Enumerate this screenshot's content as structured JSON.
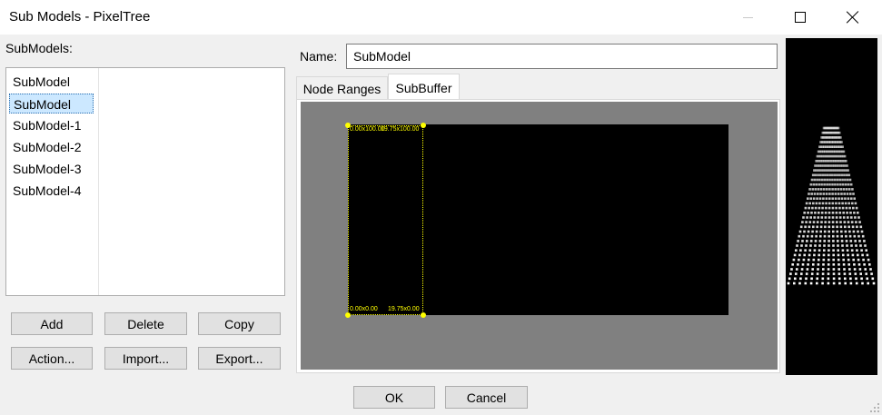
{
  "window": {
    "title": "Sub Models - PixelTree"
  },
  "submodels": {
    "label": "SubModels:",
    "items": [
      "SubModel",
      "SubModel",
      "SubModel-1",
      "SubModel-2",
      "SubModel-3",
      "SubModel-4"
    ],
    "selected_index": 1
  },
  "buttons": {
    "add": "Add",
    "delete": "Delete",
    "copy": "Copy",
    "action": "Action...",
    "import": "Import...",
    "export": "Export..."
  },
  "name": {
    "label": "Name:",
    "value": "SubModel"
  },
  "tabs": {
    "node_ranges": "Node Ranges",
    "subbuffer": "SubBuffer",
    "active": "SubBuffer"
  },
  "subbuffer": {
    "top_left": "0.00x100.00",
    "top_right": "19.75x100.00",
    "bottom_left": "0.00x0.00",
    "bottom_right": "19.75x0.00"
  },
  "dialog": {
    "ok": "OK",
    "cancel": "Cancel"
  },
  "colors": {
    "selection_outline": "#ffff00",
    "canvas_background": "#808080",
    "model_background": "#000000",
    "preview_dots": "#ffffff",
    "list_selection": "#cce8ff"
  }
}
